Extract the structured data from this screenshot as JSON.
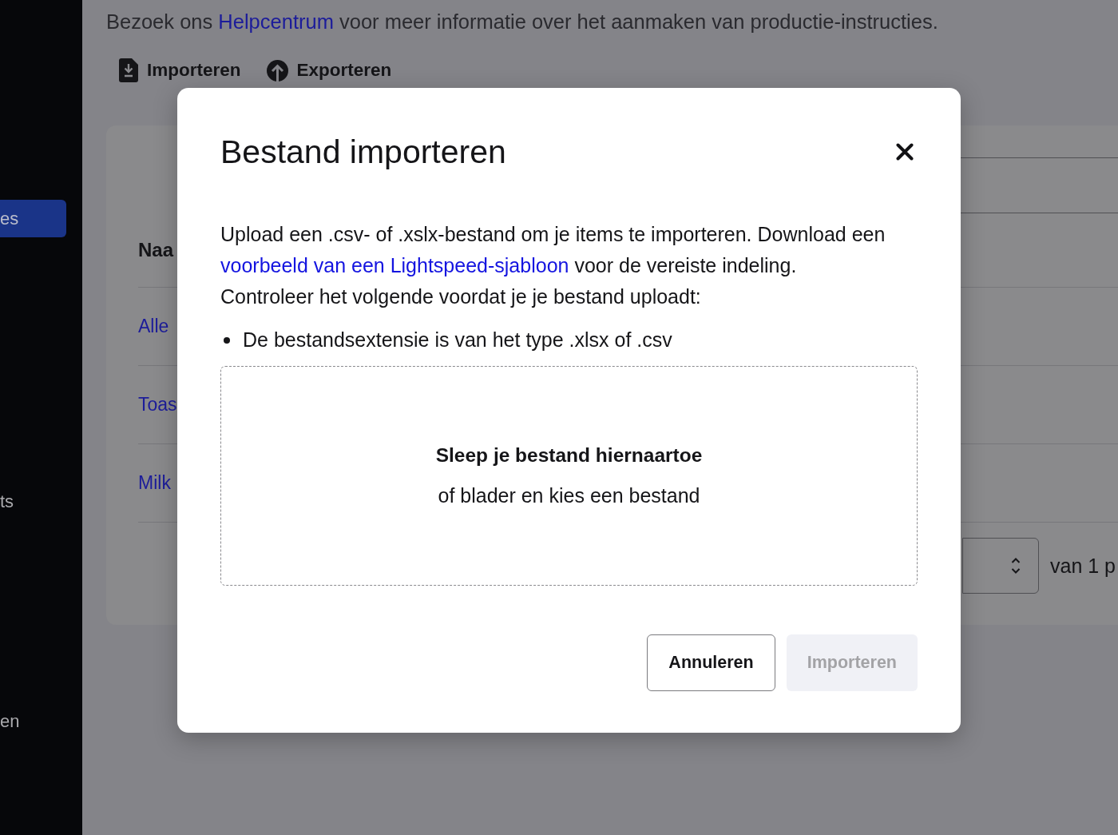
{
  "sidebar": {
    "items": [
      {
        "label": "es",
        "selected": true
      },
      {
        "label": "ts",
        "selected": false
      },
      {
        "label": "en",
        "selected": false
      }
    ]
  },
  "page": {
    "help_text": {
      "before": "Bezoek ons ",
      "link": "Helpcentrum",
      "after": " voor meer informatie over het aanmaken van productie-instructies."
    },
    "actions": [
      {
        "label": "Importeren",
        "kind": "import"
      },
      {
        "label": "Exporteren",
        "kind": "export"
      }
    ]
  },
  "table": {
    "column_1": "Naa",
    "rows": [
      "Alle",
      "Toas",
      "Milk"
    ],
    "pagination": {
      "text": "van 1 p"
    }
  },
  "dialog": {
    "title": "Bestand importeren",
    "intro": {
      "before": "Upload een .csv- of .xslx-bestand om je items te importeren. Download een ",
      "link": "voorbeeld van een Lightspeed-sjabloon",
      "after": " voor de vereiste indeling."
    },
    "check_text": "Controleer het volgende voordat je je bestand uploadt:",
    "requirements": [
      "De bestandsextensie is van het type .xlsx of .csv"
    ],
    "dropzone": {
      "title": "Sleep je bestand hiernaartoe",
      "subtitle": "of blader en kies een bestand"
    },
    "buttons": [
      {
        "label": "Annuleren",
        "kind": "secondary",
        "disabled": false
      },
      {
        "label": "Importeren",
        "kind": "primary",
        "disabled": true
      }
    ]
  }
}
